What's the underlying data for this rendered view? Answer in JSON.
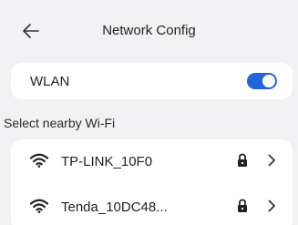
{
  "header": {
    "title": "Network Config",
    "back_icon": "arrow-left-icon"
  },
  "wlan": {
    "label": "WLAN",
    "enabled": true,
    "toggle_color": "#2563d9"
  },
  "section": {
    "label": "Select nearby Wi-Fi"
  },
  "networks": [
    {
      "ssid": "TP-LINK_10F0",
      "secured": true,
      "icon": "wifi-icon"
    },
    {
      "ssid": "Tenda_10DC48...",
      "secured": true,
      "icon": "wifi-icon"
    }
  ]
}
